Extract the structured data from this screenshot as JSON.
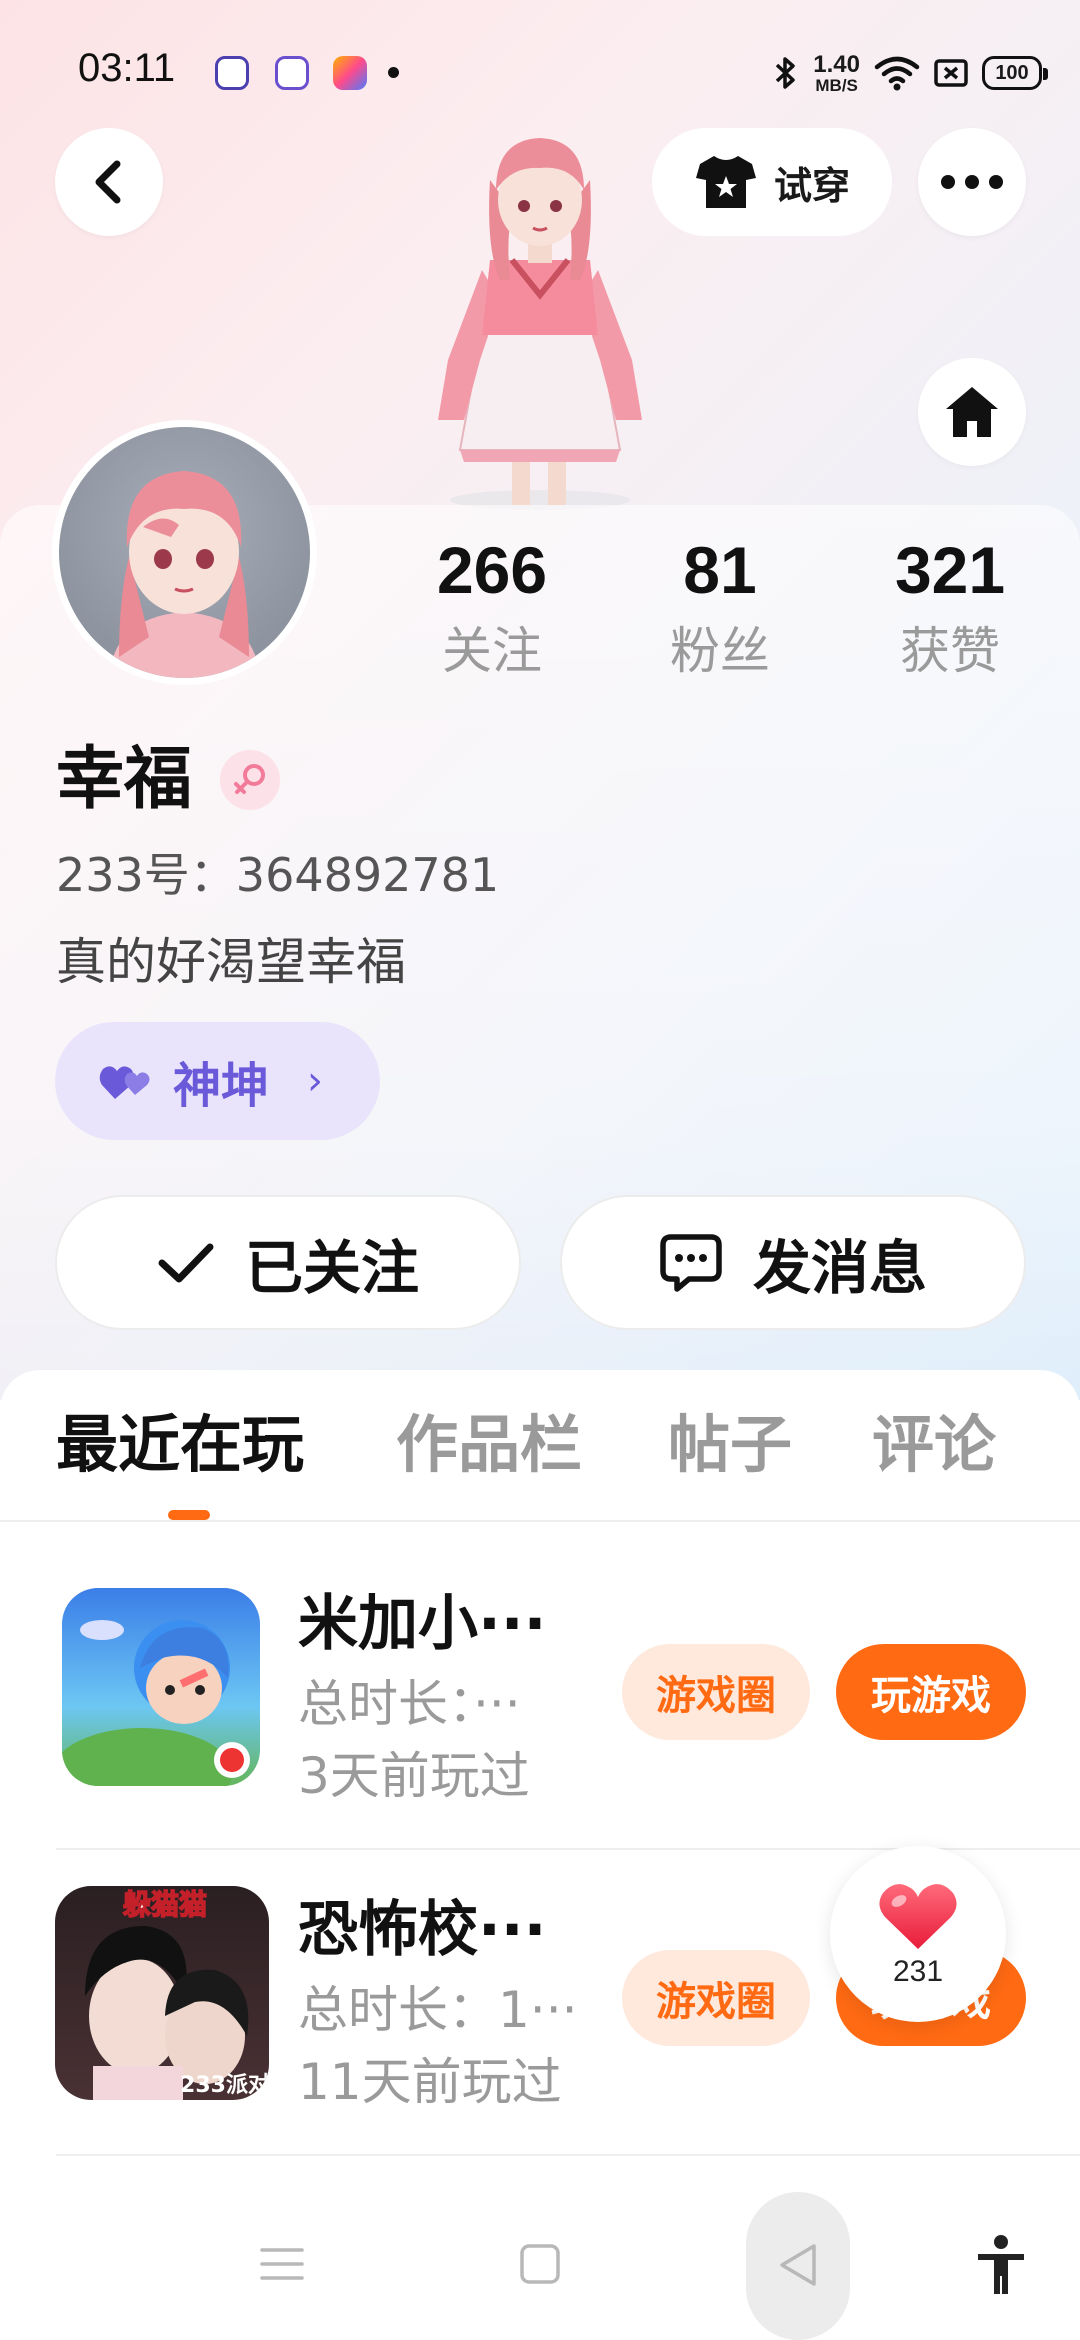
{
  "status_bar": {
    "time": "03:11",
    "net_speed_value": "1.40",
    "net_speed_unit": "MB/S",
    "battery": "100"
  },
  "header": {
    "tryon_label": "试穿"
  },
  "stats": [
    {
      "value": "266",
      "label": "关注"
    },
    {
      "value": "81",
      "label": "粉丝"
    },
    {
      "value": "321",
      "label": "获赞"
    }
  ],
  "profile": {
    "name": "幸福",
    "id_text": "233号：364892781",
    "bio": "真的好渴望幸福",
    "tag": "神坤"
  },
  "actions": {
    "follow_label": "已关注",
    "message_label": "发消息"
  },
  "tabs": [
    "最近在玩",
    "作品栏",
    "帖子",
    "评论"
  ],
  "games": [
    {
      "name": "米加小···",
      "duration": "总时长：···",
      "last_played": "3天前玩过",
      "circle_label": "游戏圈",
      "play_label": "玩游戏"
    },
    {
      "name": "恐怖校···",
      "duration": "总时长：1···",
      "last_played": "11天前玩过",
      "circle_label": "游戏圈",
      "play_label": "玩游戏",
      "icon_text_top": "躲猫猫",
      "icon_text_bottom": "233派对"
    }
  ],
  "like_float": {
    "count": "231"
  },
  "colors": {
    "accent": "#ff6a13",
    "tag_purple": "#6a59d8",
    "tag_bg": "#e9e4fb"
  }
}
